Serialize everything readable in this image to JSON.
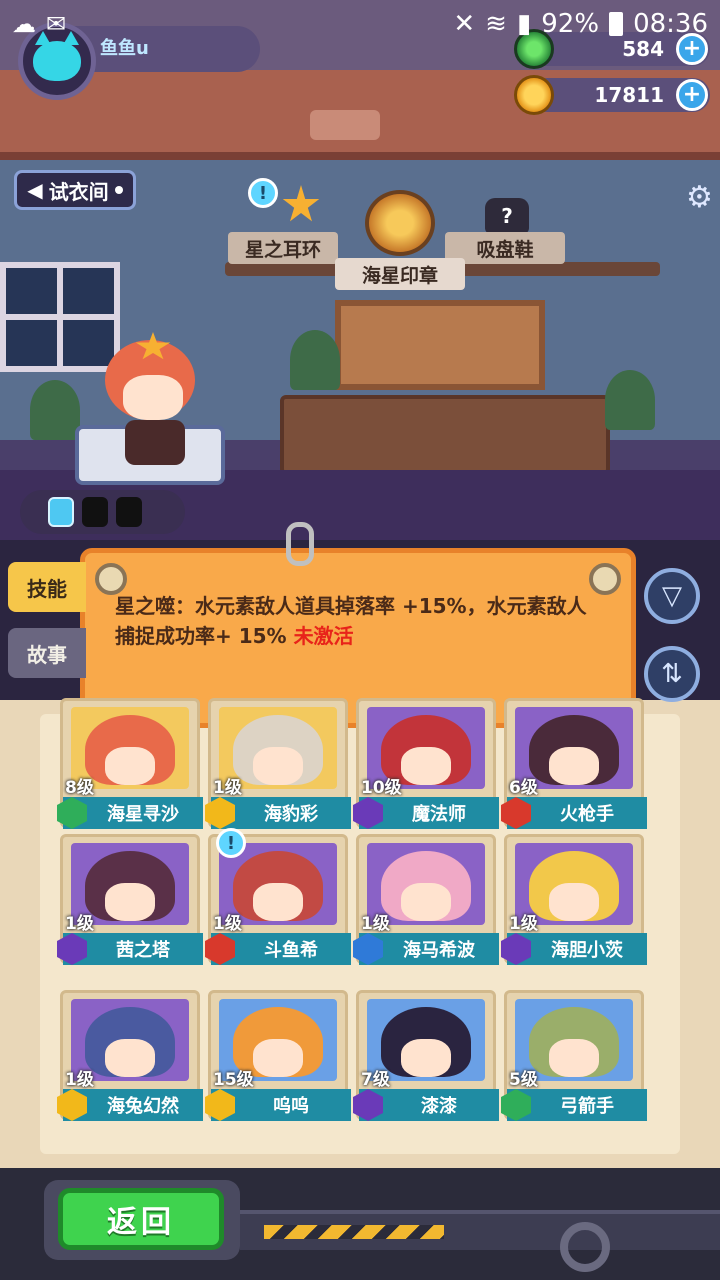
{
  "status_bar": {
    "battery": "92%",
    "time": "08:36"
  },
  "profile": {
    "username": "鱼鱼u"
  },
  "currencies": [
    {
      "icon": "green-gem-icon",
      "value": "584"
    },
    {
      "icon": "gold-coin-icon",
      "value": "17811"
    }
  ],
  "location_button": {
    "label": "试衣间"
  },
  "equipment": {
    "earring": "星之耳环",
    "badge": "海星印章",
    "shoes": "吸盘鞋",
    "shoes_unknown_mark": "?"
  },
  "alert_mark": "!",
  "tabs": {
    "skill": "技能",
    "story": "故事"
  },
  "skill": {
    "description": "星之噬：水元素敌人道具掉落率 +15%，水元素敌人捕捉成功率+ 15%",
    "status": "未激活"
  },
  "characters": [
    {
      "level": "8级",
      "name": "海星寻沙",
      "element": "green",
      "hair": "#e86a4a",
      "bg": "#f3c95e"
    },
    {
      "level": "1级",
      "name": "海豹彩",
      "element": "gold",
      "hair": "#ddd3c4",
      "bg": "#f3c95e"
    },
    {
      "level": "10级",
      "name": "魔法师",
      "element": "purple",
      "hair": "#c2343a",
      "bg": "#8a62c6"
    },
    {
      "level": "6级",
      "name": "火枪手",
      "element": "red",
      "hair": "#4a2a3a",
      "bg": "#8a62c6"
    },
    {
      "level": "1级",
      "name": "茜之塔",
      "element": "purple",
      "hair": "#5a3048",
      "bg": "#8a62c6"
    },
    {
      "level": "1级",
      "name": "斗鱼希",
      "element": "red",
      "hair": "#c24a44",
      "bg": "#8a62c6"
    },
    {
      "level": "1级",
      "name": "海马希波",
      "element": "blue",
      "hair": "#f0a9c6",
      "bg": "#8a62c6"
    },
    {
      "level": "1级",
      "name": "海胆小茨",
      "element": "purple",
      "hair": "#f2c84a",
      "bg": "#8a62c6"
    },
    {
      "level": "1级",
      "name": "海兔幻然",
      "element": "gold",
      "hair": "#4a5aa0",
      "bg": "#8a62c6"
    },
    {
      "level": "15级",
      "name": "呜呜",
      "element": "gold",
      "hair": "#f09a3a",
      "bg": "#6aa0e6"
    },
    {
      "level": "7级",
      "name": "漆漆",
      "element": "purple",
      "hair": "#2a2440",
      "bg": "#6aa0e6"
    },
    {
      "level": "5级",
      "name": "弓箭手",
      "element": "green",
      "hair": "#9aae6a",
      "bg": "#6aa0e6"
    }
  ],
  "element_colors": {
    "green": "#2fae5a",
    "gold": "#f2b81a",
    "purple": "#6a3ab8",
    "red": "#d8392c",
    "blue": "#2f7ad8"
  },
  "bottom": {
    "back_label": "返回"
  }
}
